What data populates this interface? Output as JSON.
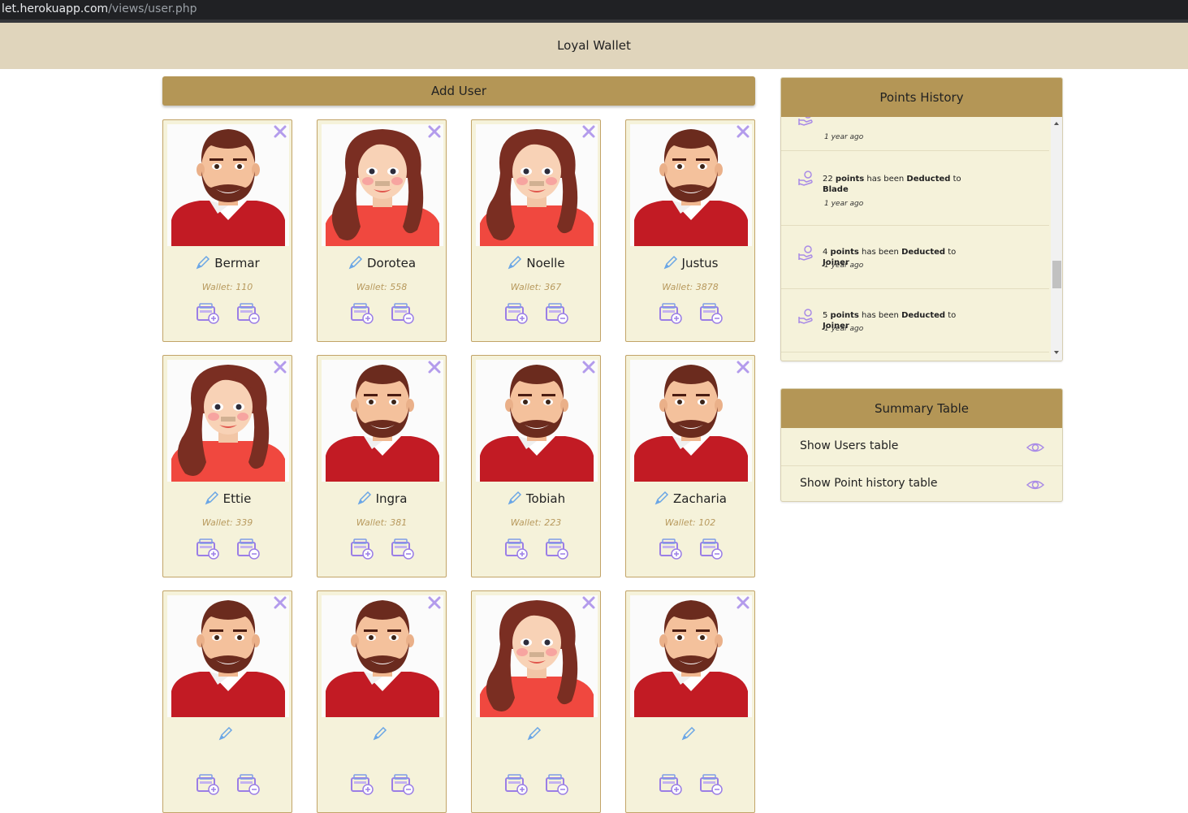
{
  "browser": {
    "url_host": "let.herokuapp.com",
    "url_path": "/views/user.php"
  },
  "app": {
    "title": "Loyal Wallet"
  },
  "toolbar": {
    "add_user_label": "Add User"
  },
  "users": [
    {
      "name": "Bermar",
      "wallet": "Wallet: 110",
      "avatar": "male"
    },
    {
      "name": "Dorotea",
      "wallet": "Wallet: 558",
      "avatar": "female"
    },
    {
      "name": "Noelle",
      "wallet": "Wallet: 367",
      "avatar": "female"
    },
    {
      "name": "Justus",
      "wallet": "Wallet: 3878",
      "avatar": "male"
    },
    {
      "name": "Ettie",
      "wallet": "Wallet: 339",
      "avatar": "female"
    },
    {
      "name": "Ingra",
      "wallet": "Wallet: 381",
      "avatar": "male"
    },
    {
      "name": "Tobiah",
      "wallet": "Wallet: 223",
      "avatar": "male"
    },
    {
      "name": "Zacharia",
      "wallet": "Wallet: 102",
      "avatar": "male"
    },
    {
      "name": "",
      "wallet": "",
      "avatar": "male"
    },
    {
      "name": "",
      "wallet": "",
      "avatar": "male"
    },
    {
      "name": "",
      "wallet": "",
      "avatar": "female"
    },
    {
      "name": "",
      "wallet": "",
      "avatar": "male"
    }
  ],
  "points_history": {
    "title": "Points History",
    "items": [
      {
        "pre": "",
        "points": "",
        "mid": "",
        "action": "",
        "to": "",
        "target": "",
        "time": "1 year ago"
      },
      {
        "pre": "22 ",
        "points": "points",
        "mid": " has been ",
        "action": "Deducted",
        "to": " to ",
        "target": "Blade",
        "time": "1 year ago"
      },
      {
        "pre": "4 ",
        "points": "points",
        "mid": " has been ",
        "action": "Deducted",
        "to": " to ",
        "target": "Joiner",
        "time": "1 year ago"
      },
      {
        "pre": "5 ",
        "points": "points",
        "mid": " has been ",
        "action": "Deducted",
        "to": " to ",
        "target": "Joiner",
        "time": "1 year ago"
      }
    ]
  },
  "summary": {
    "title": "Summary Table",
    "rows": [
      {
        "label": "Show Users table",
        "icon": "eye-icon"
      },
      {
        "label": "Show Point history table",
        "icon": "eye-icon"
      }
    ]
  },
  "colors": {
    "header_bg": "#e0d5bc",
    "accent": "#b49656",
    "card_bg": "#f5f2da",
    "icon_purple": "#a98be6"
  }
}
